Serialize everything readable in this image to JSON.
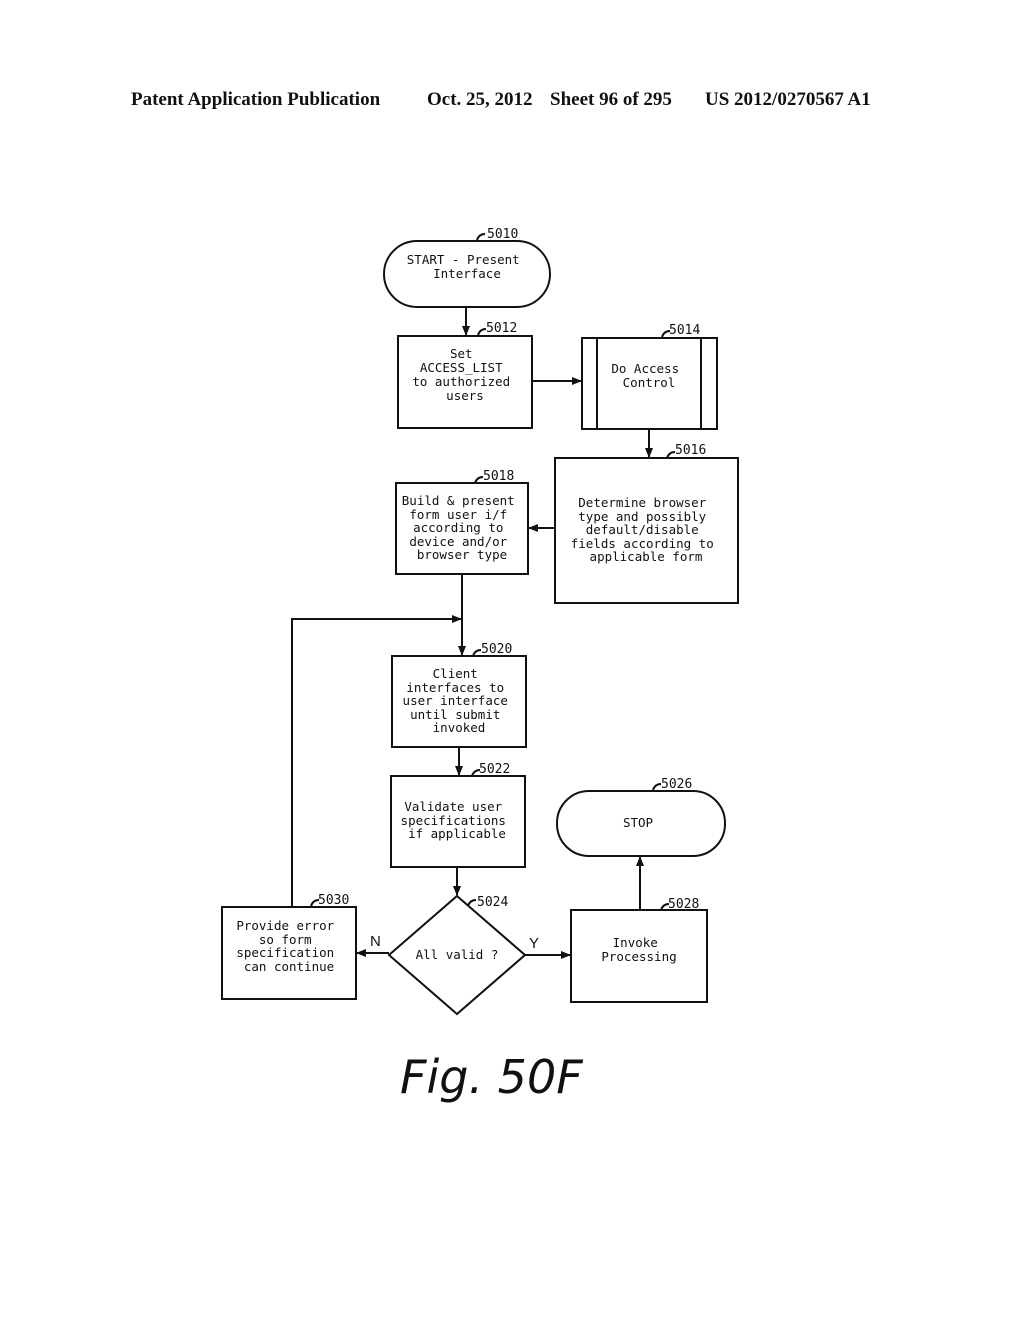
{
  "header": {
    "publication": "Patent Application Publication",
    "date": "Oct. 25, 2012",
    "sheet": "Sheet 96 of 295",
    "number": "US 2012/0270567 A1"
  },
  "figure_label": "Fig. 50F",
  "nodes": {
    "n5010": {
      "ref": "5010",
      "type": "terminal",
      "lines": [
        "START - Present",
        "Interface"
      ]
    },
    "n5012": {
      "ref": "5012",
      "type": "process",
      "lines": [
        "Set",
        "ACCESS_LIST",
        "to authorized",
        "users"
      ]
    },
    "n5014": {
      "ref": "5014",
      "type": "predefined-process",
      "lines": [
        "Do Access",
        "Control"
      ]
    },
    "n5016": {
      "ref": "5016",
      "type": "process",
      "lines": [
        "Determine browser",
        "type and possibly",
        "default/disable",
        "fields according to",
        "applicable form"
      ]
    },
    "n5018": {
      "ref": "5018",
      "type": "process",
      "lines": [
        "Build & present",
        "form user i/f",
        "according to",
        "device and/or",
        "browser type"
      ]
    },
    "n5020": {
      "ref": "5020",
      "type": "process",
      "lines": [
        "Client",
        "interfaces to",
        "user interface",
        "until submit",
        "invoked"
      ]
    },
    "n5022": {
      "ref": "5022",
      "type": "process",
      "lines": [
        "Validate user",
        "specifications",
        "if applicable"
      ]
    },
    "n5024": {
      "ref": "5024",
      "type": "decision",
      "lines": [
        "All valid ?"
      ]
    },
    "n5026": {
      "ref": "5026",
      "type": "terminal",
      "lines": [
        "STOP"
      ]
    },
    "n5028": {
      "ref": "5028",
      "type": "process",
      "lines": [
        "Invoke",
        "Processing"
      ]
    },
    "n5030": {
      "ref": "5030",
      "type": "process",
      "lines": [
        "Provide error",
        "so form",
        "specification",
        "can continue"
      ]
    }
  },
  "edges": [
    {
      "from": "5010",
      "to": "5012",
      "label": ""
    },
    {
      "from": "5012",
      "to": "5014",
      "label": ""
    },
    {
      "from": "5014",
      "to": "5016",
      "label": ""
    },
    {
      "from": "5016",
      "to": "5018",
      "label": ""
    },
    {
      "from": "5018",
      "to": "5020",
      "label": ""
    },
    {
      "from": "5020",
      "to": "5022",
      "label": ""
    },
    {
      "from": "5022",
      "to": "5024",
      "label": ""
    },
    {
      "from": "5024",
      "to": "5028",
      "label": "Y"
    },
    {
      "from": "5024",
      "to": "5030",
      "label": "N"
    },
    {
      "from": "5028",
      "to": "5026",
      "label": ""
    },
    {
      "from": "5030",
      "to": "5020",
      "label": ""
    }
  ],
  "edge_labels": {
    "yes": "Y",
    "no": "N"
  }
}
